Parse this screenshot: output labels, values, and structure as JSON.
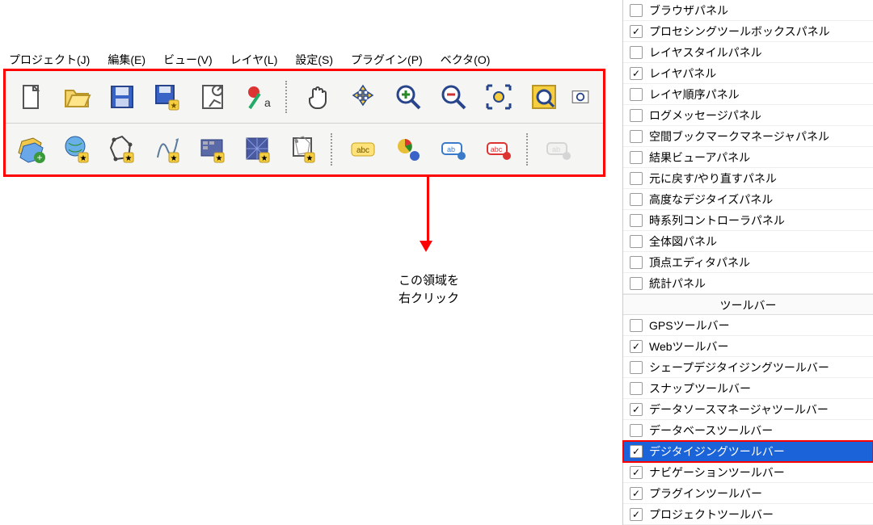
{
  "menu": {
    "project": "プロジェクト(J)",
    "edit": "編集(E)",
    "view": "ビュー(V)",
    "layer": "レイヤ(L)",
    "settings": "設定(S)",
    "plugins": "プラグイン(P)",
    "vector": "ベクタ(O)"
  },
  "annotation": {
    "line1": "この領域を",
    "line2": "右クリック"
  },
  "context": {
    "panels": [
      {
        "label": "ブラウザパネル",
        "checked": false
      },
      {
        "label": "プロセシングツールボックスパネル",
        "checked": true
      },
      {
        "label": "レイヤスタイルパネル",
        "checked": false
      },
      {
        "label": "レイヤパネル",
        "checked": true
      },
      {
        "label": "レイヤ順序パネル",
        "checked": false
      },
      {
        "label": "ログメッセージパネル",
        "checked": false
      },
      {
        "label": "空間ブックマークマネージャパネル",
        "checked": false
      },
      {
        "label": "結果ビューアパネル",
        "checked": false
      },
      {
        "label": "元に戻す/やり直すパネル",
        "checked": false
      },
      {
        "label": "高度なデジタイズパネル",
        "checked": false
      },
      {
        "label": "時系列コントローラパネル",
        "checked": false
      },
      {
        "label": "全体図パネル",
        "checked": false
      },
      {
        "label": "頂点エディタパネル",
        "checked": false
      },
      {
        "label": "統計パネル",
        "checked": false
      }
    ],
    "toolbarsHeader": "ツールバー",
    "toolbars": [
      {
        "label": "GPSツールバー",
        "checked": false
      },
      {
        "label": "Webツールバー",
        "checked": true
      },
      {
        "label": "シェープデジタイジングツールバー",
        "checked": false
      },
      {
        "label": "スナップツールバー",
        "checked": false
      },
      {
        "label": "データソースマネージャツールバー",
        "checked": true
      },
      {
        "label": "データベースツールバー",
        "checked": false
      },
      {
        "label": "デジタイジングツールバー",
        "checked": true,
        "selected": true,
        "highlight": true
      },
      {
        "label": "ナビゲーションツールバー",
        "checked": true
      },
      {
        "label": "プラグインツールバー",
        "checked": true
      },
      {
        "label": "プロジェクトツールバー",
        "checked": true
      }
    ]
  },
  "icons": {
    "new": "new-project-icon",
    "open": "open-folder-icon",
    "save": "save-icon",
    "save-as": "save-as-icon",
    "layout": "layout-manager-icon",
    "style": "style-manager-icon",
    "pan": "pan-icon",
    "pan-select": "pan-selection-icon",
    "zoom-in": "zoom-in-icon",
    "zoom-out": "zoom-out-icon",
    "zoom-full": "zoom-full-icon",
    "zoom-layer": "zoom-layer-icon",
    "zoom-native": "zoom-native-icon",
    "addv": "add-vector-icon",
    "addr": "add-raster-icon",
    "add-mesh": "add-mesh-icon",
    "add-delimited": "add-delimited-icon",
    "add-wms": "add-wms-icon",
    "add-xyz": "add-xyz-icon",
    "add-vt": "add-virtual-icon",
    "label-abc": "label-abc-icon",
    "diagram": "diagram-icon",
    "label-rule": "label-rule-icon",
    "label-rule2": "label-rule-red-icon",
    "label-off": "label-off-icon"
  }
}
